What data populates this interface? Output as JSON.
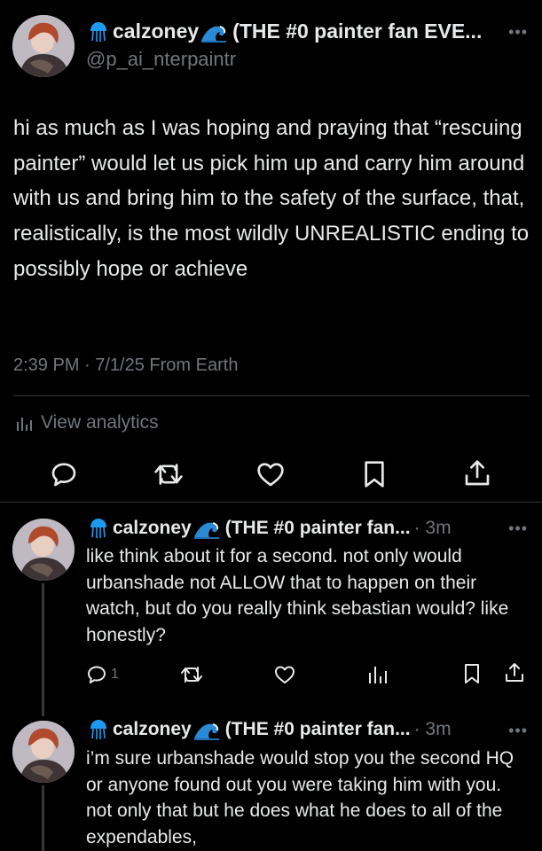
{
  "main_tweet": {
    "display_name": "calzoney",
    "display_suffix": "(THE #0 painter fan EVE...",
    "handle": "@p_ai_nterpaintr",
    "text": "hi as much as I was hoping and praying that “rescuing painter” would let us pick him up and carry him around with us and bring him to the safety of the surface, that, realistically, is the most wildly UNREALISTIC ending to possibly hope or achieve",
    "meta": "2:39 PM · 7/1/25 From Earth",
    "analytics_label": "View analytics",
    "more": "•••"
  },
  "replies": [
    {
      "display_name": "calzoney",
      "display_suffix": "(THE #0 painter fan...",
      "time": "· 3m",
      "text": "like think about it for a second. not only would urbanshade not ALLOW that to happen on their watch, but do you really think sebastian would? like honestly?",
      "reply_count": "1",
      "more": "•••"
    },
    {
      "display_name": "calzoney",
      "display_suffix": "(THE #0 painter fan...",
      "time": "· 3m",
      "text": "i’m sure urbanshade would stop you the second HQ or anyone found out you were taking him with you. not only that but he does what he does to all of the expendables,",
      "more": "•••"
    }
  ],
  "colors": {
    "background": "#000000",
    "text": "#e7e9ea",
    "secondary": "#71767b",
    "divider": "#2f3336",
    "jellyfish": "#1d9bf0"
  },
  "icons": [
    "jellyfish-emoji",
    "wave-emoji",
    "more-icon",
    "analytics-icon",
    "reply-icon",
    "repost-icon",
    "like-icon",
    "bookmark-icon",
    "share-icon",
    "views-icon"
  ]
}
